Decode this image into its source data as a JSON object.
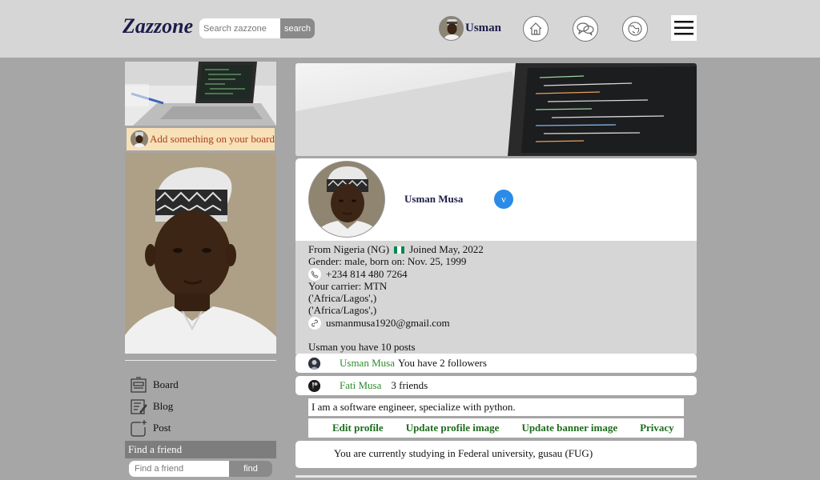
{
  "header": {
    "logo": "Zazzone",
    "search_placeholder": "Search zazzone",
    "search_button": "search",
    "username": "Usman",
    "icons": [
      "home-icon",
      "chat-icon",
      "globe-icon",
      "hamburger-menu-icon"
    ]
  },
  "sidebar": {
    "add_board": "Add something on your board",
    "nav": [
      {
        "label": "Board",
        "icon": "board-icon"
      },
      {
        "label": "Blog",
        "icon": "blog-icon"
      },
      {
        "label": "Post",
        "icon": "post-icon"
      }
    ],
    "find_friend_title": "Find a friend",
    "find_friend_placeholder": "Find a friend",
    "find_button": "find"
  },
  "profile": {
    "name": "Usman Musa",
    "verified_badge": "v",
    "from_label": "From Nigeria (NG)",
    "joined": "Joined May, 2022",
    "gender_line": "Gender: male, born on: Nov. 25, 1999",
    "phone": "+234 814 480 7264",
    "carrier": "Your carrier: MTN",
    "timezone_1": "('Africa/Lagos',)",
    "timezone_2": "('Africa/Lagos',)",
    "email": "usmanmusa1920@gmail.com",
    "posts_line": "Usman you have 10 posts",
    "flag_colors": [
      "#008751",
      "#ffffff",
      "#008751"
    ]
  },
  "followers_row": {
    "name": "Usman Musa",
    "text": "You have 2 followers"
  },
  "friends_row": {
    "name": "Fati Musa",
    "text": "3 friends"
  },
  "bio": "I am a software engineer, specialize with python.",
  "actions": [
    "Edit profile",
    "Update profile image",
    "Update banner image",
    "Privacy"
  ],
  "study": "You are currently studying in Federal university, gusau (FUG)"
}
